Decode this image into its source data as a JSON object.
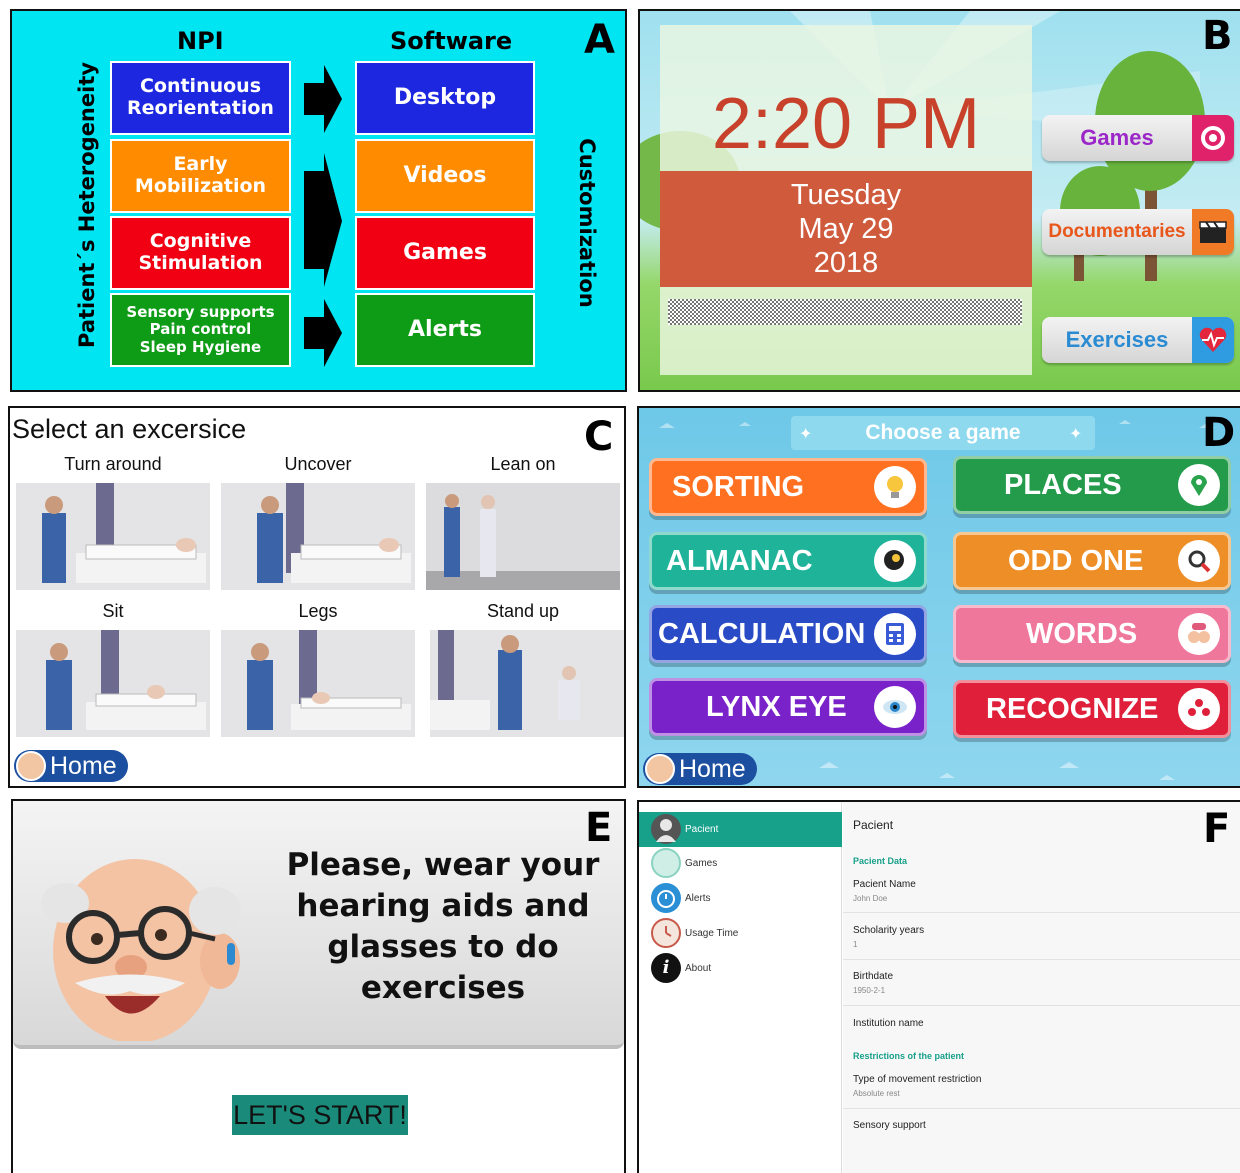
{
  "panel_letters": [
    "A",
    "B",
    "C",
    "D",
    "E",
    "F"
  ],
  "panelA": {
    "header_left": "NPI",
    "header_right": "Software",
    "left_vertical_label": "Patient´s Heterogeneity",
    "right_vertical_label": "Customization",
    "npi_items": [
      {
        "lines": [
          "Continuous",
          "Reorientation"
        ],
        "color": "#1d27e0"
      },
      {
        "lines": [
          "Early",
          "Mobilization"
        ],
        "color": "#ff8c00"
      },
      {
        "lines": [
          "Cognitive",
          "Stimulation"
        ],
        "color": "#f00012"
      },
      {
        "lines": [
          "Sensory supports",
          "Pain control",
          "Sleep Hygiene"
        ],
        "color": "#0e9b16"
      }
    ],
    "software_items": [
      {
        "label": "Desktop",
        "color": "#1d27e0"
      },
      {
        "label": "Videos",
        "color": "#ff8c00"
      },
      {
        "label": "Games",
        "color": "#f00012"
      },
      {
        "label": "Alerts",
        "color": "#0e9b16"
      }
    ]
  },
  "panelB": {
    "time": "2:20 PM",
    "weekday": "Tuesday",
    "monthday": "May 29",
    "year": "2018",
    "buttons": [
      {
        "label": "Games",
        "color": "#9b27c9",
        "icon": "target-icon",
        "icon_bg": "#e0226b"
      },
      {
        "label": "Documentaries",
        "color": "#e9561a",
        "icon": "clapperboard-icon",
        "icon_bg": "#f07a26"
      },
      {
        "label": "Exercises",
        "color": "#2a8bd2",
        "icon": "heart-pulse-icon",
        "icon_bg": "#2f9be0"
      }
    ]
  },
  "panelC": {
    "title": "Select an excersice",
    "exercises": [
      "Turn around",
      "Uncover",
      "Lean on",
      "Sit",
      "Legs",
      "Stand up"
    ],
    "home_label": "Home"
  },
  "panelD": {
    "banner": "Choose a game",
    "games": [
      {
        "label": "SORTING",
        "color": "#ff7020",
        "icon": "lightbulb-icon"
      },
      {
        "label": "PLACES",
        "color": "#239b4b",
        "icon": "map-pin-icon"
      },
      {
        "label": "ALMANAC",
        "color": "#1fb39a",
        "icon": "head-gears-icon"
      },
      {
        "label": "ODD ONE",
        "color": "#ee8e26",
        "icon": "magnifier-icon"
      },
      {
        "label": "CALCULATION",
        "color": "#2a4bc6",
        "icon": "calculator-icon"
      },
      {
        "label": "WORDS",
        "color": "#f0779c",
        "icon": "speech-people-icon"
      },
      {
        "label": "LYNX EYE",
        "color": "#7a22c9",
        "icon": "eye-icon"
      },
      {
        "label": "RECOGNIZE",
        "color": "#e0203a",
        "icon": "people-icon"
      }
    ],
    "home_label": "Home"
  },
  "panelE": {
    "message_lines": [
      "Please, wear your",
      "hearing aids and",
      "glasses to do",
      "exercises"
    ],
    "start_label": "LET'S START!"
  },
  "panelF": {
    "sidebar": [
      {
        "label": "Pacient",
        "icon": "user-icon",
        "active": true
      },
      {
        "label": "Games",
        "icon": "games-icon",
        "active": false
      },
      {
        "label": "Alerts",
        "icon": "alarm-clock-icon",
        "active": false
      },
      {
        "label": "Usage Time",
        "icon": "clock-icon",
        "active": false
      },
      {
        "label": "About",
        "icon": "info-icon",
        "active": false
      }
    ],
    "title": "Pacient",
    "section_data": "Pacient Data",
    "fields": [
      {
        "label": "Pacient Name",
        "value": "John Doe"
      },
      {
        "label": "Scholarity years",
        "value": "1"
      },
      {
        "label": "Birthdate",
        "value": "1950-2-1"
      },
      {
        "label": "Institution name",
        "value": ""
      }
    ],
    "section_restrictions": "Restrictions of the patient",
    "restriction_fields": [
      {
        "label": "Type of movement restriction",
        "value": "Absolute rest"
      },
      {
        "label": "Sensory support",
        "value": ""
      }
    ],
    "accent": "#17a08a"
  }
}
